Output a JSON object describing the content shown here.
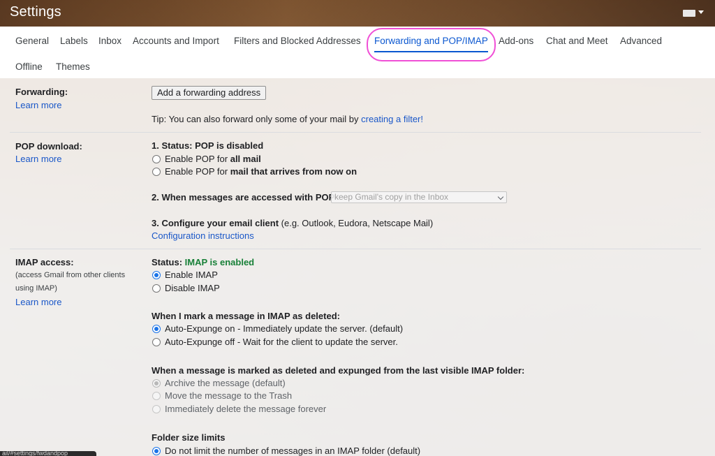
{
  "header": {
    "title": "Settings",
    "keyboard_icon": "keyboard-icon"
  },
  "tabs": [
    {
      "label": "General"
    },
    {
      "label": "Labels"
    },
    {
      "label": "Inbox"
    },
    {
      "label": "Accounts and Import"
    },
    {
      "label": "Filters and Blocked Addresses"
    },
    {
      "label": "Forwarding and POP/IMAP",
      "active": true
    },
    {
      "label": "Add-ons"
    },
    {
      "label": "Chat and Meet"
    },
    {
      "label": "Advanced"
    },
    {
      "label": "Offline"
    },
    {
      "label": "Themes"
    }
  ],
  "forwarding": {
    "label": "Forwarding:",
    "learn_more": "Learn more",
    "add_button": "Add a forwarding address",
    "tip_prefix": "Tip: You can also forward only some of your mail by ",
    "tip_link": "creating a filter!"
  },
  "pop": {
    "label": "POP download:",
    "learn_more": "Learn more",
    "status_heading": "1. Status: POP is disabled",
    "opt1_prefix": "Enable POP for ",
    "opt1_bold": "all mail",
    "opt2_prefix": "Enable POP for ",
    "opt2_bold": "mail that arrives from now on",
    "access_heading": "2. When messages are accessed with POP",
    "access_select": "keep Gmail's copy in the Inbox",
    "configure_heading": "3. Configure your email client",
    "configure_hint": " (e.g. Outlook, Eudora, Netscape Mail)",
    "configure_link": "Configuration instructions"
  },
  "imap": {
    "label": "IMAP access:",
    "sub_line1": "(access Gmail from other clients",
    "sub_line2": "using IMAP)",
    "learn_more": "Learn more",
    "status_prefix": "Status: ",
    "status_value": "IMAP is enabled",
    "enable": "Enable IMAP",
    "disable": "Disable IMAP",
    "deleted_heading": "When I mark a message in IMAP as deleted:",
    "expunge_on": "Auto-Expunge on - Immediately update the server. (default)",
    "expunge_off": "Auto-Expunge off - Wait for the client to update the server.",
    "expunged_heading": "When a message is marked as deleted and expunged from the last visible IMAP folder:",
    "archive": "Archive the message (default)",
    "trash": "Move the message to the Trash",
    "delete_forever": "Immediately delete the message forever",
    "folder_heading": "Folder size limits",
    "no_limit": "Do not limit the number of messages in an IMAP folder (default)"
  },
  "statusbar": {
    "url": "ail/#settings/fwdandpop"
  },
  "colors": {
    "accent": "#0b57d0",
    "link": "#1a57c8",
    "enabled_green": "#188038",
    "highlight": "#f04fd6"
  }
}
